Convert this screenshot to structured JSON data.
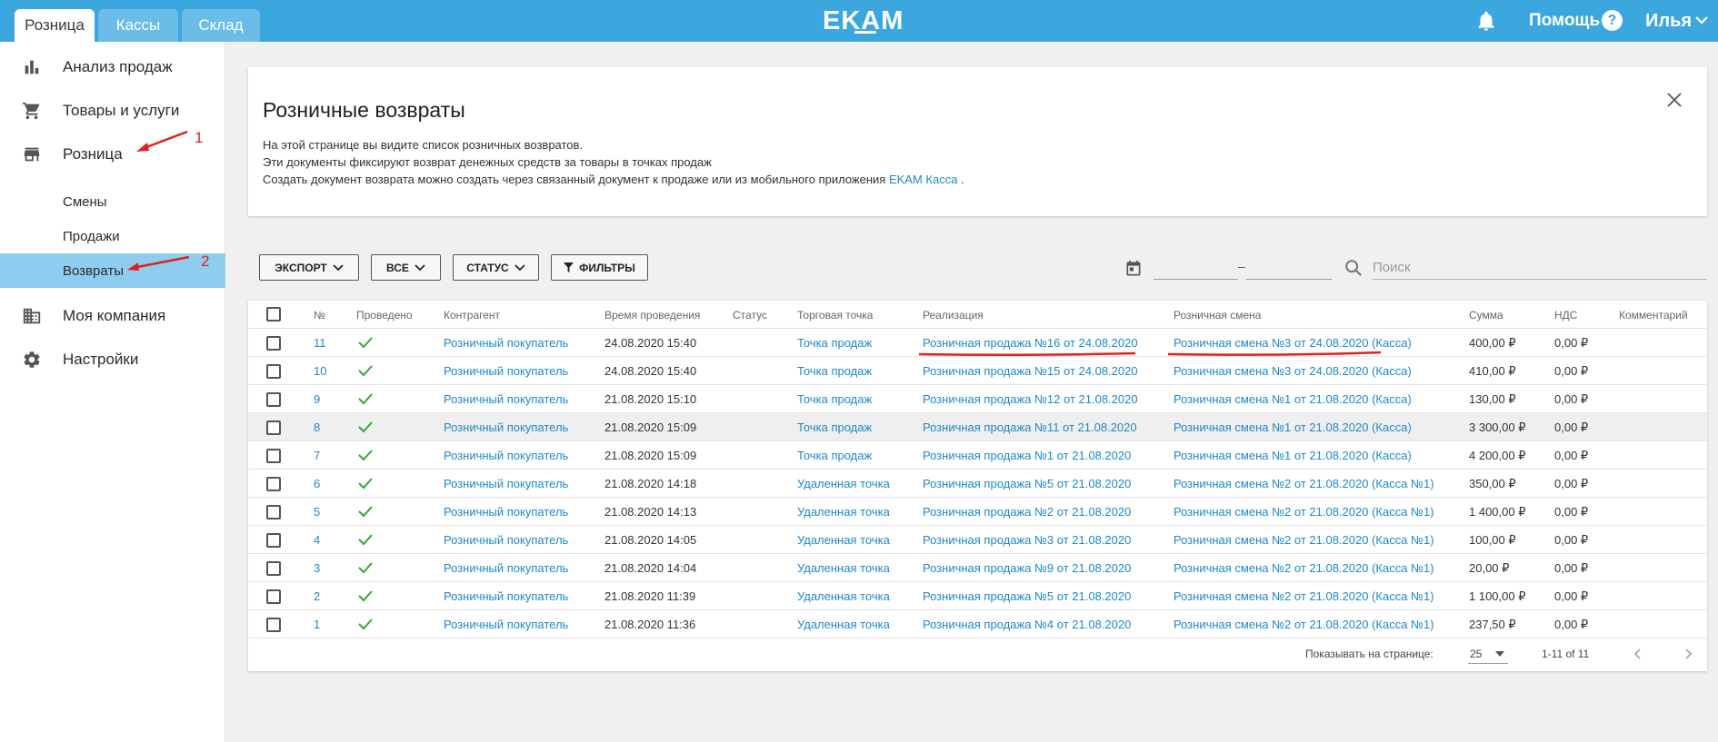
{
  "topbar": {
    "tabs": [
      {
        "label": "Розница",
        "active": true
      },
      {
        "label": "Кассы",
        "active": false
      },
      {
        "label": "Склад",
        "active": false
      }
    ],
    "logo": "EKAM",
    "bell_icon": "bell-icon",
    "help_label": "Помощь",
    "help_icon": "?",
    "user_label": "Илья"
  },
  "sidebar": {
    "items": [
      {
        "label": "Анализ продаж",
        "icon": "bar-chart-icon"
      },
      {
        "label": "Товары и услуги",
        "icon": "cart-icon"
      },
      {
        "label": "Розница",
        "icon": "store-icon"
      },
      {
        "label": "Моя компания",
        "icon": "building-icon"
      },
      {
        "label": "Настройки",
        "icon": "gear-icon"
      }
    ],
    "subitems": [
      {
        "label": "Смены",
        "active": false
      },
      {
        "label": "Продажи",
        "active": false
      },
      {
        "label": "Возвраты",
        "active": true
      }
    ],
    "annotations": [
      "1",
      "2"
    ]
  },
  "info": {
    "title": "Розничные возвраты",
    "line1": "На этой странице вы видите список розничных возвратов.",
    "line2": "Эти документы фиксируют возврат денежных средств за товары в точках продаж",
    "line3_prefix": "Создать документ возврата можно создать через связанный документ к продаже или из мобильного приложения",
    "line3_link": "EKAM Касса",
    "line3_suffix": "."
  },
  "toolbar": {
    "export_label": "ЭКСПОРТ",
    "all_label": "ВСЕ",
    "status_label": "СТАТУС",
    "filters_label": "ФИЛЬТРЫ",
    "date_from": "",
    "date_to": "",
    "dash": "–",
    "search_placeholder": "Поиск"
  },
  "table": {
    "columns": [
      "№",
      "Проведено",
      "Контрагент",
      "Время проведения",
      "Статус",
      "Торговая точка",
      "Реализация",
      "Розничная смена",
      "Сумма",
      "НДС",
      "Комментарий"
    ],
    "rows": [
      {
        "num": "11",
        "partner": "Розничный покупатель",
        "time": "24.08.2020 15:40",
        "status": "",
        "point": "Точка продаж",
        "sale": "Розничная продажа №16 от 24.08.2020",
        "shift": "Розничная смена №3 от 24.08.2020 (Касса)",
        "sum": "400,00 ₽",
        "vat": "0,00 ₽",
        "comment": ""
      },
      {
        "num": "10",
        "partner": "Розничный покупатель",
        "time": "24.08.2020 15:40",
        "status": "",
        "point": "Точка продаж",
        "sale": "Розничная продажа №15 от 24.08.2020",
        "shift": "Розничная смена №3 от 24.08.2020 (Касса)",
        "sum": "410,00 ₽",
        "vat": "0,00 ₽",
        "comment": ""
      },
      {
        "num": "9",
        "partner": "Розничный покупатель",
        "time": "21.08.2020 15:10",
        "status": "",
        "point": "Точка продаж",
        "sale": "Розничная продажа №12 от 21.08.2020",
        "shift": "Розничная смена №1 от 21.08.2020 (Касса)",
        "sum": "130,00 ₽",
        "vat": "0,00 ₽",
        "comment": ""
      },
      {
        "num": "8",
        "partner": "Розничный покупатель",
        "time": "21.08.2020 15:09",
        "status": "",
        "point": "Точка продаж",
        "sale": "Розничная продажа №11 от 21.08.2020",
        "shift": "Розничная смена №1 от 21.08.2020 (Касса)",
        "sum": "3 300,00 ₽",
        "vat": "0,00 ₽",
        "comment": ""
      },
      {
        "num": "7",
        "partner": "Розничный покупатель",
        "time": "21.08.2020 15:09",
        "status": "",
        "point": "Точка продаж",
        "sale": "Розничная продажа №1 от 21.08.2020",
        "shift": "Розничная смена №1 от 21.08.2020 (Касса)",
        "sum": "4 200,00 ₽",
        "vat": "0,00 ₽",
        "comment": ""
      },
      {
        "num": "6",
        "partner": "Розничный покупатель",
        "time": "21.08.2020 14:18",
        "status": "",
        "point": "Удаленная точка",
        "sale": "Розничная продажа №5 от 21.08.2020",
        "shift": "Розничная смена №2 от 21.08.2020 (Касса №1)",
        "sum": "350,00 ₽",
        "vat": "0,00 ₽",
        "comment": ""
      },
      {
        "num": "5",
        "partner": "Розничный покупатель",
        "time": "21.08.2020 14:13",
        "status": "",
        "point": "Удаленная точка",
        "sale": "Розничная продажа №2 от 21.08.2020",
        "shift": "Розничная смена №2 от 21.08.2020 (Касса №1)",
        "sum": "1 400,00 ₽",
        "vat": "0,00 ₽",
        "comment": ""
      },
      {
        "num": "4",
        "partner": "Розничный покупатель",
        "time": "21.08.2020 14:05",
        "status": "",
        "point": "Удаленная точка",
        "sale": "Розничная продажа №3 от 21.08.2020",
        "shift": "Розничная смена №2 от 21.08.2020 (Касса №1)",
        "sum": "100,00 ₽",
        "vat": "0,00 ₽",
        "comment": ""
      },
      {
        "num": "3",
        "partner": "Розничный покупатель",
        "time": "21.08.2020 14:04",
        "status": "",
        "point": "Удаленная точка",
        "sale": "Розничная продажа №9 от 21.08.2020",
        "shift": "Розничная смена №2 от 21.08.2020 (Касса №1)",
        "sum": "20,00 ₽",
        "vat": "0,00 ₽",
        "comment": ""
      },
      {
        "num": "2",
        "partner": "Розничный покупатель",
        "time": "21.08.2020 11:39",
        "status": "",
        "point": "Удаленная точка",
        "sale": "Розничная продажа №5 от 21.08.2020",
        "shift": "Розничная смена №2 от 21.08.2020 (Касса №1)",
        "sum": "1 100,00 ₽",
        "vat": "0,00 ₽",
        "comment": ""
      },
      {
        "num": "1",
        "partner": "Розничный покупатель",
        "time": "21.08.2020 11:36",
        "status": "",
        "point": "Удаленная точка",
        "sale": "Розничная продажа №4 от 21.08.2020",
        "shift": "Розничная смена №2 от 21.08.2020 (Касса №1)",
        "sum": "237,50 ₽",
        "vat": "0,00 ₽",
        "comment": ""
      }
    ],
    "footer": {
      "per_page_label": "Показывать на странице:",
      "per_page_value": "25",
      "range": "1-11 of 11"
    }
  },
  "colors": {
    "topbar": "#3ca7df",
    "link": "#1e88c9",
    "active_sub": "#8fcdf0",
    "check": "#3aa33a",
    "annotation": "#e02020"
  }
}
